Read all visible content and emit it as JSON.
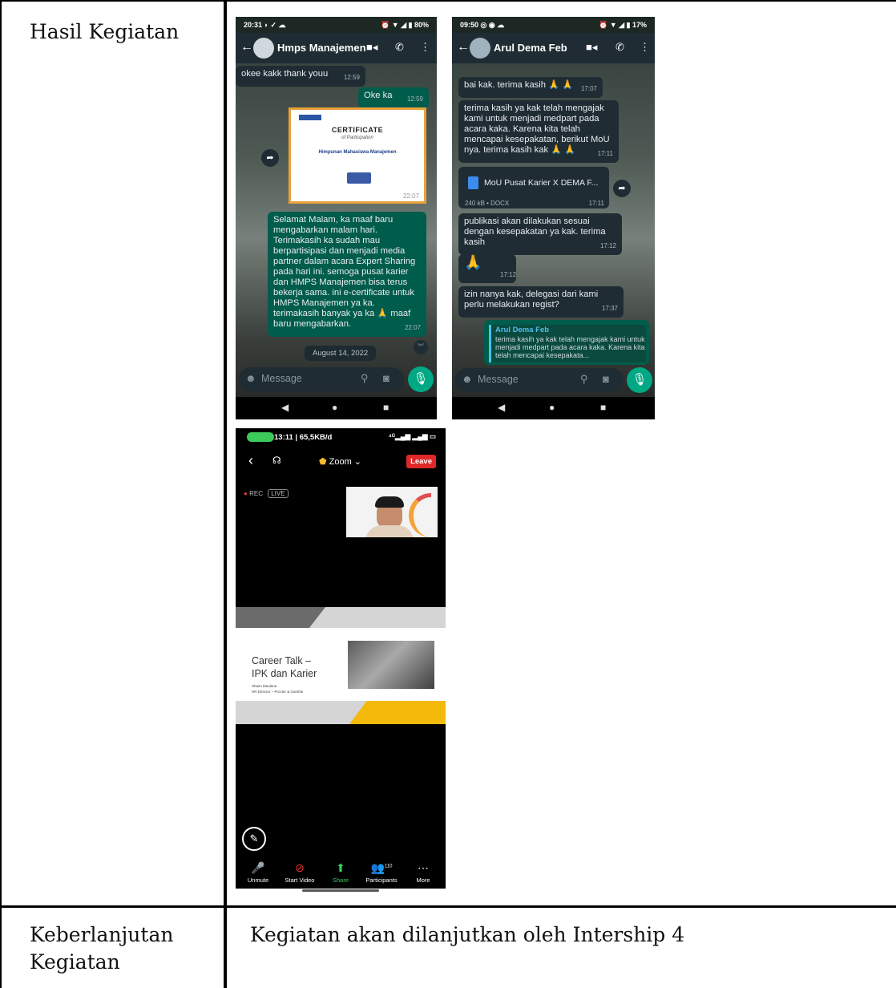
{
  "table": {
    "row1_label": "Hasil Kegiatan",
    "row2_label_line1": "Keberlanjutan",
    "row2_label_line2": "Kegiatan",
    "row2_value": "Kegiatan akan dilanjutkan oleh Intership 4"
  },
  "chat1": {
    "status_time": "20:31",
    "status_battery": "80%",
    "contact_name": "Hmps Manajemen",
    "messages": [
      {
        "text": "okee kakk thank youu",
        "time": "12:59"
      },
      {
        "text": "Oke ka",
        "time": "12:59"
      },
      {
        "text": "Selamat Malam, ka maaf baru mengabarkan malam hari. Terimakasih ka sudah mau berpartisipasi dan menjadi media partner dalam acara Expert Sharing pada hari ini. semoga pusat karier dan HMPS Manajemen bisa terus bekerja sama. ini e-certificate untuk HMPS Manajemen  ya ka. terimakasih banyak ya ka 🙏 maaf baru mengabarkan.",
        "time": "22:07"
      }
    ],
    "certificate": {
      "title": "CERTIFICATE",
      "subtitle": "of Participation",
      "recipient": "Himpunan Mahasiswa Manajemen",
      "image_time": "22:07"
    },
    "date_pill": "August 14, 2022",
    "input_placeholder": "Message"
  },
  "chat2": {
    "status_time": "09:50",
    "status_battery": "17%",
    "contact_name": "Arul Dema Feb",
    "messages": [
      {
        "text": "bai kak. terima kasih 🙏 🙏",
        "time": "17:07"
      },
      {
        "text": "terima kasih ya kak telah mengajak kami untuk menjadi medpart pada acara kaka. Karena kita telah mencapai kesepakatan, berikut MoU nya. terima kasih kak 🙏 🙏",
        "time": "17:11"
      },
      {
        "text": "publikasi akan dilakukan sesuai dengan kesepakatan ya kak. terima kasih",
        "time": "17:12"
      },
      {
        "text": "🙏",
        "time": "17:12"
      },
      {
        "text": "izin nanya kak, delegasi dari kami perlu melakukan regist?",
        "time": "17:37"
      }
    ],
    "document": {
      "name": "MoU Pusat Karier X DEMA F...",
      "meta": "240 kB • DOCX",
      "time": "17:11"
    },
    "reply": {
      "author": "Arul Dema Feb",
      "text": "terima kasih ya kak telah mengajak kami untuk menjadi medpart pada acara kaka. Karena kita telah mencapai kesepakata..."
    },
    "input_placeholder": "Message"
  },
  "zoom": {
    "status_text": "13:11 | 65,5KB/d",
    "title": "Zoom",
    "leave_label": "Leave",
    "rec_label": "REC",
    "live_label": "LIVE",
    "slide_title_line1": "Career Talk –",
    "slide_title_line2": "IPK dan Karier",
    "slide_speaker": "Shaim Maulana",
    "slide_role": "HR Director – Procter & Gamble",
    "participants_count": "110",
    "toolbar": [
      {
        "label": "Unmute",
        "icon": "mic-off-icon"
      },
      {
        "label": "Start Video",
        "icon": "video-off-icon"
      },
      {
        "label": "Share",
        "icon": "share-icon"
      },
      {
        "label": "Participants",
        "icon": "participants-icon"
      },
      {
        "label": "More",
        "icon": "more-icon"
      }
    ]
  }
}
